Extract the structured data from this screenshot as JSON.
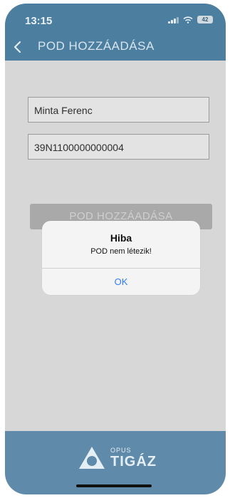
{
  "status_bar": {
    "time": "13:15",
    "battery": "42"
  },
  "header": {
    "title": "POD HOZZÁADÁSA"
  },
  "form": {
    "name_value": "Minta Ferenc",
    "pod_value": "39N1100000000004",
    "add_button_label": "POD HOZZÁADÁSA"
  },
  "alert": {
    "title": "Hiba",
    "message": "POD nem létezik!",
    "ok_label": "OK"
  },
  "footer": {
    "logo_small": "OPUS",
    "logo_big": "TIGÁZ"
  },
  "colors": {
    "header": "#4c7ea0",
    "footer": "#5f8aaa",
    "ok_text": "#2f7cf6"
  }
}
